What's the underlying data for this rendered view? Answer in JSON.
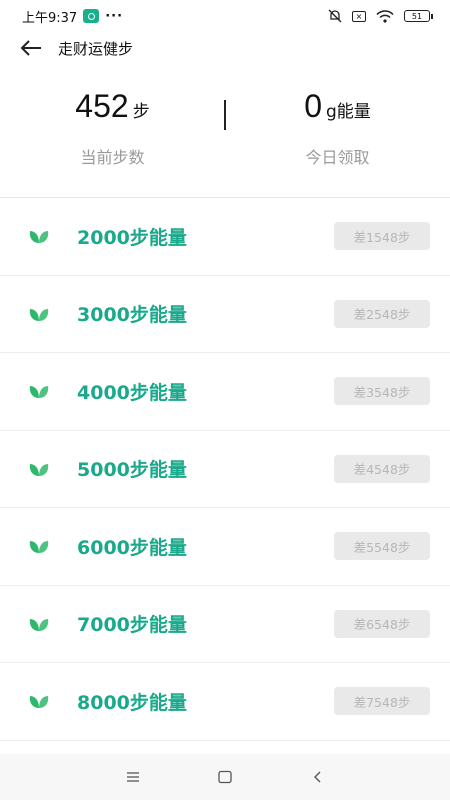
{
  "status_bar": {
    "time": "上午9:37",
    "dots": "···",
    "battery": "51"
  },
  "header": {
    "title": "走财运健步"
  },
  "summary": {
    "steps_value": "452",
    "steps_unit": "步",
    "steps_label": "当前步数",
    "energy_value": "0",
    "energy_unit": "g能量",
    "energy_label": "今日领取"
  },
  "rows": [
    {
      "label": "2000步能量",
      "button": "差1548步"
    },
    {
      "label": "3000步能量",
      "button": "差2548步"
    },
    {
      "label": "4000步能量",
      "button": "差3548步"
    },
    {
      "label": "5000步能量",
      "button": "差4548步"
    },
    {
      "label": "6000步能量",
      "button": "差5548步"
    },
    {
      "label": "7000步能量",
      "button": "差6548步"
    },
    {
      "label": "8000步能量",
      "button": "差7548步"
    }
  ],
  "colors": {
    "accent": "#1aa98a",
    "leaf": "#2fb86b",
    "button_bg": "#e9e9e9",
    "button_text": "#b7b7b7"
  },
  "icons": {
    "back": "arrow-left-icon",
    "leaf": "leaf-icon",
    "nav_menu": "menu-icon",
    "nav_home": "square-home-icon",
    "nav_back": "chevron-left-icon"
  }
}
